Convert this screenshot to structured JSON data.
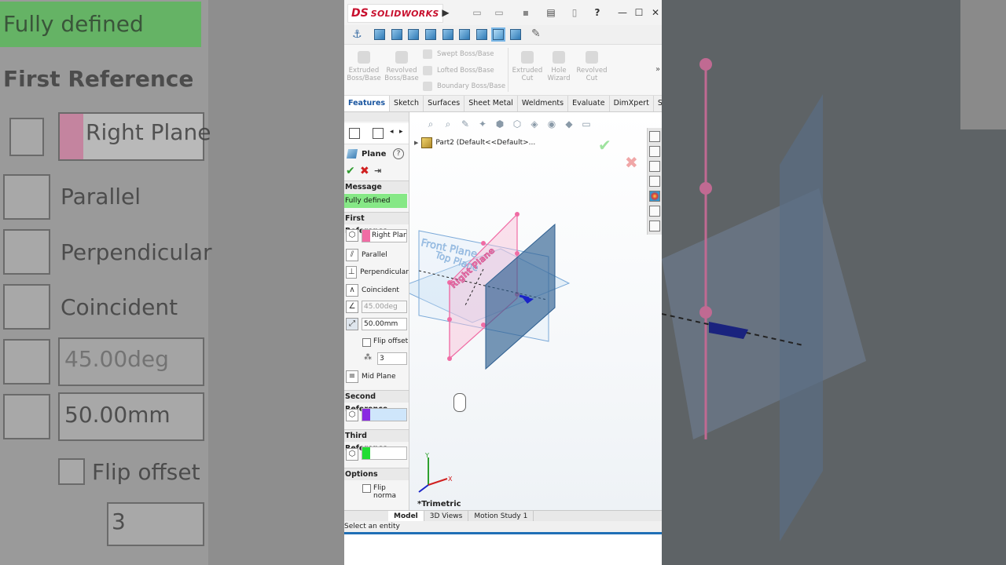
{
  "background": {
    "message_value": "Fully defined",
    "first_reference_heading": "First Reference",
    "first_reference_value": "Right Plane",
    "parallel": "Parallel",
    "perpendicular": "Perpendicular",
    "coincident": "Coincident",
    "angle": "45.00deg",
    "offset": "50.00mm",
    "flip_offset": "Flip offset",
    "instances": "3"
  },
  "app": {
    "brand_ds": "DS",
    "brand_name": "SOLIDWORKS",
    "help": "?"
  },
  "ribbon": {
    "extruded_boss": "Extruded Boss/Base",
    "revolved_boss": "Revolved Boss/Base",
    "swept_boss": "Swept Boss/Base",
    "lofted_boss": "Lofted Boss/Base",
    "boundary_boss": "Boundary Boss/Base",
    "extruded_cut": "Extruded Cut",
    "hole_wizard": "Hole Wizard",
    "revolved_cut": "Revolved Cut"
  },
  "tabs": [
    "Features",
    "Sketch",
    "Surfaces",
    "Sheet Metal",
    "Weldments",
    "Evaluate",
    "DimXpert",
    "SOLIDW..."
  ],
  "property_manager": {
    "title": "Plane",
    "message_heading": "Message",
    "message_value": "Fully defined",
    "first_reference_heading": "First Reference",
    "first_reference_value": "Right Plane",
    "parallel": "Parallel",
    "perpendicular": "Perpendicular",
    "coincident": "Coincident",
    "angle": "45.00deg",
    "offset": "50.00mm",
    "flip_offset": "Flip offset",
    "instances": "3",
    "mid_plane": "Mid Plane",
    "second_reference_heading": "Second Reference",
    "third_reference_heading": "Third Reference",
    "options_heading": "Options",
    "flip_normal": "Flip norma"
  },
  "graphics": {
    "tree_part": "Part2  (Default<<Default>...",
    "view_label": "*Trimetric",
    "plane_front": "Front Plane",
    "plane_top": "Top Plane",
    "plane_right": "Right Plane",
    "axis_x": "X",
    "axis_y": "Y"
  },
  "bottom_tabs": [
    "Model",
    "3D Views",
    "Motion Study 1"
  ],
  "status": "Select an entity",
  "colors": {
    "first_ref": "#f06ca4",
    "second_ref": "#8a2be2",
    "third_ref": "#22dd33",
    "message_bg": "#86e886",
    "accent": "#1f6fb6"
  }
}
